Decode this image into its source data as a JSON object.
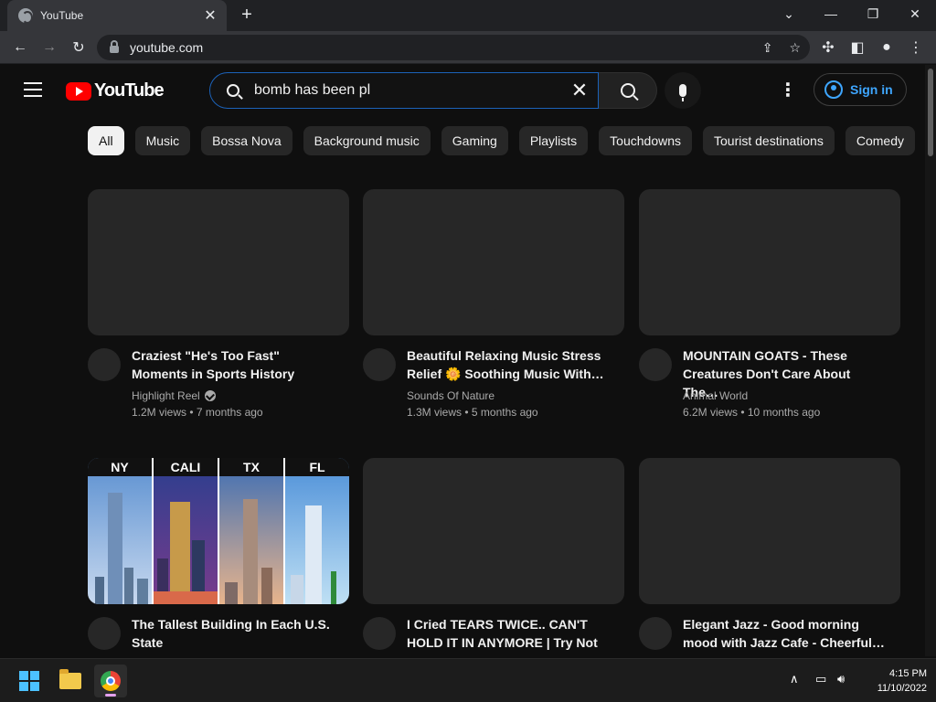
{
  "browser": {
    "tab_title": "YouTube",
    "new_tab": "+",
    "url": "youtube.com"
  },
  "youtube": {
    "logo_text": "YouTube",
    "search": {
      "query": "bomb has been pl"
    },
    "sign_in_label": "Sign in",
    "chips": [
      "All",
      "Music",
      "Bossa Nova",
      "Background music",
      "Gaming",
      "Playlists",
      "Touchdowns",
      "Tourist destinations",
      "Comedy"
    ],
    "active_chip": "All",
    "videos": [
      {
        "title": "Craziest \"He's Too Fast\" Moments in Sports History",
        "channel": "Highlight Reel",
        "verified": true,
        "stats": "1.2M views • 7 months ago"
      },
      {
        "title": "Beautiful Relaxing Music Stress Relief 🌼 Soothing Music With…",
        "channel": "Sounds Of Nature",
        "verified": false,
        "stats": "1.3M views • 5 months ago"
      },
      {
        "title": "MOUNTAIN GOATS - These Creatures Don't Care About The…",
        "channel": "Animal World",
        "verified": false,
        "stats": "6.2M views • 10 months ago"
      },
      {
        "title": "The Tallest Building In Each U.S. State",
        "channel": "",
        "verified": false,
        "stats": "",
        "thumb_labels": [
          "NY",
          "CALI",
          "TX",
          "FL"
        ]
      },
      {
        "title": "I Cried TEARS TWICE.. CAN'T HOLD IT IN ANYMORE | Try Not …",
        "channel": "",
        "verified": false,
        "stats": ""
      },
      {
        "title": "Elegant Jazz - Good morning mood with Jazz Cafe - Cheerful…",
        "channel": "",
        "verified": false,
        "stats": ""
      }
    ]
  },
  "taskbar": {
    "time": "4:15 PM",
    "date": "11/10/2022"
  },
  "colors": {
    "background": "#0f0f0f",
    "chip": "#272727",
    "accent_link": "#3ea6ff",
    "youtube_red": "#ff0000",
    "search_focus": "#1c62b9"
  }
}
